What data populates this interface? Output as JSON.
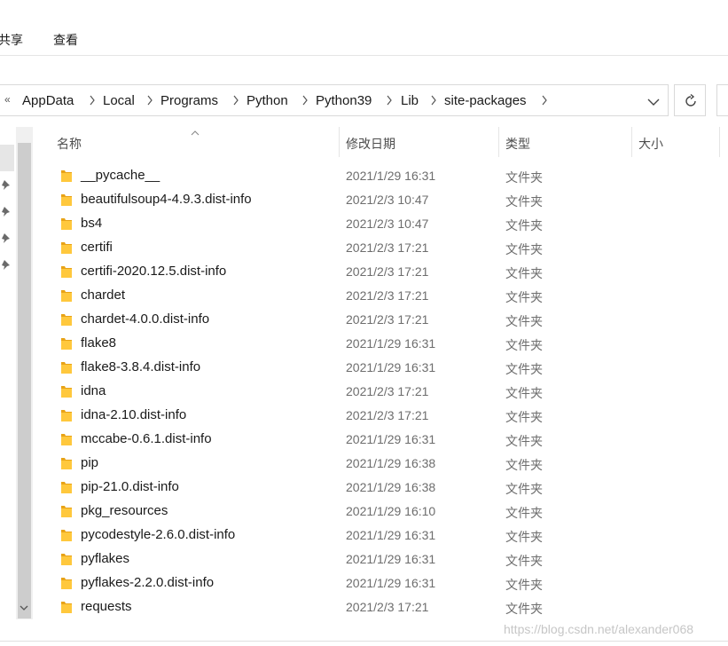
{
  "ribbon": {
    "tabs": [
      "共享",
      "查看"
    ]
  },
  "address": {
    "overflow_glyph": "«",
    "crumbs": [
      "AppData",
      "Local",
      "Programs",
      "Python",
      "Python39",
      "Lib",
      "site-packages"
    ]
  },
  "columns": {
    "name": "名称",
    "date": "修改日期",
    "type": "类型",
    "size": "大小"
  },
  "files": [
    {
      "name": "__pycache__",
      "date": "2021/1/29 16:31",
      "type": "文件夹"
    },
    {
      "name": "beautifulsoup4-4.9.3.dist-info",
      "date": "2021/2/3 10:47",
      "type": "文件夹"
    },
    {
      "name": "bs4",
      "date": "2021/2/3 10:47",
      "type": "文件夹"
    },
    {
      "name": "certifi",
      "date": "2021/2/3 17:21",
      "type": "文件夹"
    },
    {
      "name": "certifi-2020.12.5.dist-info",
      "date": "2021/2/3 17:21",
      "type": "文件夹"
    },
    {
      "name": "chardet",
      "date": "2021/2/3 17:21",
      "type": "文件夹"
    },
    {
      "name": "chardet-4.0.0.dist-info",
      "date": "2021/2/3 17:21",
      "type": "文件夹"
    },
    {
      "name": "flake8",
      "date": "2021/1/29 16:31",
      "type": "文件夹"
    },
    {
      "name": "flake8-3.8.4.dist-info",
      "date": "2021/1/29 16:31",
      "type": "文件夹"
    },
    {
      "name": "idna",
      "date": "2021/2/3 17:21",
      "type": "文件夹"
    },
    {
      "name": "idna-2.10.dist-info",
      "date": "2021/2/3 17:21",
      "type": "文件夹"
    },
    {
      "name": "mccabe-0.6.1.dist-info",
      "date": "2021/1/29 16:31",
      "type": "文件夹"
    },
    {
      "name": "pip",
      "date": "2021/1/29 16:38",
      "type": "文件夹"
    },
    {
      "name": "pip-21.0.dist-info",
      "date": "2021/1/29 16:38",
      "type": "文件夹"
    },
    {
      "name": "pkg_resources",
      "date": "2021/1/29 16:10",
      "type": "文件夹"
    },
    {
      "name": "pycodestyle-2.6.0.dist-info",
      "date": "2021/1/29 16:31",
      "type": "文件夹"
    },
    {
      "name": "pyflakes",
      "date": "2021/1/29 16:31",
      "type": "文件夹"
    },
    {
      "name": "pyflakes-2.2.0.dist-info",
      "date": "2021/1/29 16:31",
      "type": "文件夹"
    },
    {
      "name": "requests",
      "date": "2021/2/3 17:21",
      "type": "文件夹"
    }
  ],
  "watermark": "https://blog.csdn.net/alexander068",
  "colors": {
    "folder": "#ffc83d",
    "folder_dark": "#e8a317",
    "border": "#d9d9d9"
  },
  "icons": {
    "folder": "folder-icon",
    "pin": "pin-icon",
    "refresh": "refresh-icon",
    "dropdown": "chevron-down-icon"
  }
}
